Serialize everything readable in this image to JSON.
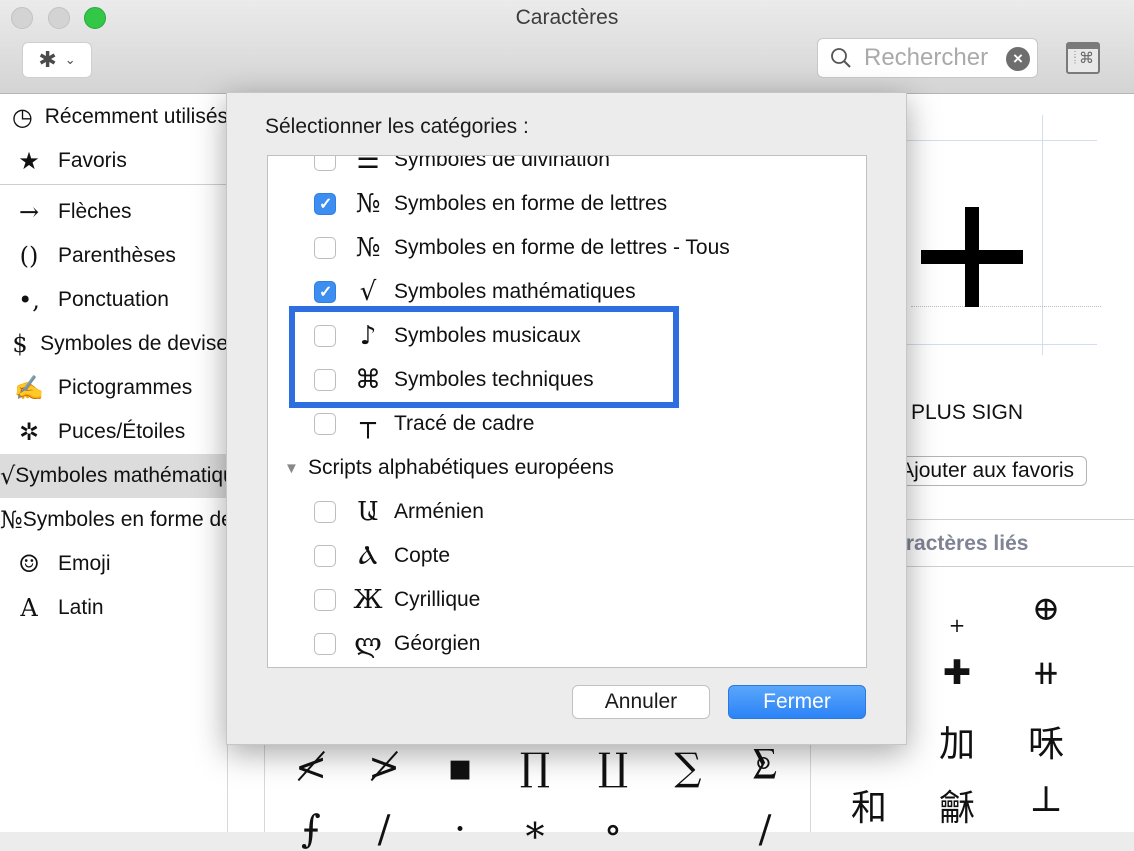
{
  "window": {
    "title": "Caractères",
    "toolbar": {
      "gear_icon": "gear-icon",
      "gear_menu_chevron": "chevron-down-icon",
      "search_placeholder": "Rechercher",
      "search_value": "",
      "clear_icon": "×",
      "viewer_icon": "⌘"
    }
  },
  "sidebar": {
    "items": [
      {
        "icon": "◷",
        "icon_name": "clock-icon",
        "label": "Récemment utilisés",
        "selected": false
      },
      {
        "icon": "★",
        "icon_name": "star-icon",
        "label": "Favoris",
        "selected": false
      },
      {
        "icon": "→",
        "icon_name": "arrow-icon",
        "label": "Flèches",
        "selected": false
      },
      {
        "icon": "()",
        "icon_name": "parentheses-icon",
        "label": "Parenthèses",
        "selected": false
      },
      {
        "icon": "•,",
        "icon_name": "punctuation-icon",
        "label": "Ponctuation",
        "selected": false
      },
      {
        "icon": "$",
        "icon_name": "dollar-icon",
        "label": "Symboles de devise",
        "selected": false
      },
      {
        "icon": "✍",
        "icon_name": "pictogram-icon",
        "label": "Pictogrammes",
        "selected": false
      },
      {
        "icon": "✲",
        "icon_name": "asterisk-icon",
        "label": "Puces/Étoiles",
        "selected": false
      },
      {
        "icon": "√",
        "icon_name": "square-root-icon",
        "label": "Symboles mathématiques",
        "selected": true
      },
      {
        "icon": "№",
        "icon_name": "numero-icon",
        "label": "Symboles en forme de lettres",
        "selected": false
      },
      {
        "icon": "☺",
        "icon_name": "smiley-icon",
        "label": "Emoji",
        "selected": false
      },
      {
        "icon": "A",
        "icon_name": "letter-a-icon",
        "label": "Latin",
        "selected": false
      }
    ]
  },
  "character_grid": {
    "visible_row": [
      "≮",
      "≯",
      "▪",
      "∏",
      "∐",
      "∑",
      "⨊"
    ],
    "partial_row": [
      "⨍",
      "∕",
      "·",
      "∗",
      "∘",
      "",
      "∕"
    ]
  },
  "inspector": {
    "glyph": "+",
    "name": "PLUS SIGN",
    "add_favorites_label": "Ajouter aux favoris",
    "related_heading": "Caractères liés",
    "related": [
      [
        "",
        "+",
        "⊕"
      ],
      [
        "",
        "✚",
        "⧺"
      ],
      [
        "",
        "加",
        "咊"
      ],
      [
        "和",
        "龢",
        "⊥"
      ]
    ]
  },
  "dialog": {
    "label": "Sélectionner les catégories :",
    "rows": [
      {
        "type": "item",
        "checked": false,
        "symbol": "☰",
        "label": "Symboles de divination"
      },
      {
        "type": "item",
        "checked": true,
        "symbol": "№",
        "label": "Symboles en forme de lettres"
      },
      {
        "type": "item",
        "checked": false,
        "symbol": "№",
        "label": "Symboles en forme de lettres - Tous"
      },
      {
        "type": "item",
        "checked": true,
        "symbol": "√",
        "label": "Symboles mathématiques"
      },
      {
        "type": "item",
        "checked": false,
        "symbol": "♪",
        "label": "Symboles musicaux"
      },
      {
        "type": "item",
        "checked": false,
        "symbol": "⌘",
        "label": "Symboles techniques"
      },
      {
        "type": "item",
        "checked": false,
        "symbol": "┬",
        "label": "Tracé de cadre"
      },
      {
        "type": "group",
        "expanded": true,
        "symbol": "▼",
        "label": "Scripts alphabétiques européens"
      },
      {
        "type": "item",
        "checked": false,
        "symbol": "Ա",
        "label": "Arménien"
      },
      {
        "type": "item",
        "checked": false,
        "symbol": "Ⲁ",
        "label": "Copte"
      },
      {
        "type": "item",
        "checked": false,
        "symbol": "Ж",
        "label": "Cyrillique"
      },
      {
        "type": "item",
        "checked": false,
        "symbol": "ლ",
        "label": "Géorgien"
      }
    ],
    "cancel_label": "Annuler",
    "close_label": "Fermer",
    "highlight_color": "#2d6fe0",
    "accent_color": "#3d8ef0"
  }
}
